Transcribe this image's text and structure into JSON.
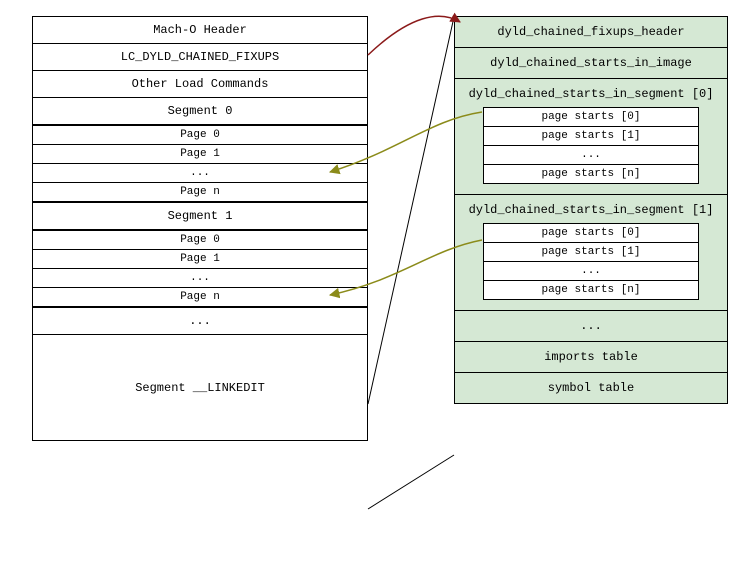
{
  "left": {
    "header": "Mach-O Header",
    "lc": "LC_DYLD_CHAINED_FIXUPS",
    "other": "Other Load Commands",
    "segments": [
      {
        "label": "Segment 0",
        "pages": [
          "Page 0",
          "Page 1",
          "...",
          "Page n"
        ]
      },
      {
        "label": "Segment 1",
        "pages": [
          "Page 0",
          "Page 1",
          "...",
          "Page n"
        ]
      }
    ],
    "ellipsis": "...",
    "linkedit": "Segment __LINKEDIT"
  },
  "right": {
    "header": "dyld_chained_fixups_header",
    "starts_in_image": "dyld_chained_starts_in_image",
    "segments": [
      {
        "label": "dyld_chained_starts_in_segment [0]",
        "pages": [
          "page starts [0]",
          "page starts [1]",
          "...",
          "page starts [n]"
        ]
      },
      {
        "label": "dyld_chained_starts_in_segment [1]",
        "pages": [
          "page starts [0]",
          "page starts [1]",
          "...",
          "page starts [n]"
        ]
      }
    ],
    "ellipsis": "...",
    "imports": "imports table",
    "symbols": "symbol table"
  },
  "colors": {
    "greenFill": "#d5e8d4",
    "arrowRed": "#8B1A1A",
    "arrowOlive": "#8B8B1A",
    "black": "#000000"
  }
}
